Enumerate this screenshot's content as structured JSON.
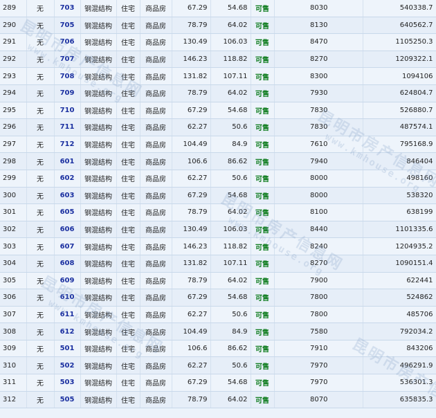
{
  "watermark": {
    "name": "昆明市房产信息网",
    "url": "www.kmhouse.org"
  },
  "rows": [
    [
      "289",
      "无",
      "703",
      "钢混结构",
      "住宅",
      "商品房",
      "67.29",
      "54.68",
      "可售",
      "8030",
      "540338.7"
    ],
    [
      "290",
      "无",
      "705",
      "钢混结构",
      "住宅",
      "商品房",
      "78.79",
      "64.02",
      "可售",
      "8130",
      "640562.7"
    ],
    [
      "291",
      "无",
      "706",
      "钢混结构",
      "住宅",
      "商品房",
      "130.49",
      "106.03",
      "可售",
      "8470",
      "1105250.3"
    ],
    [
      "292",
      "无",
      "707",
      "钢混结构",
      "住宅",
      "商品房",
      "146.23",
      "118.82",
      "可售",
      "8270",
      "1209322.1"
    ],
    [
      "293",
      "无",
      "708",
      "钢混结构",
      "住宅",
      "商品房",
      "131.82",
      "107.11",
      "可售",
      "8300",
      "1094106"
    ],
    [
      "294",
      "无",
      "709",
      "钢混结构",
      "住宅",
      "商品房",
      "78.79",
      "64.02",
      "可售",
      "7930",
      "624804.7"
    ],
    [
      "295",
      "无",
      "710",
      "钢混结构",
      "住宅",
      "商品房",
      "67.29",
      "54.68",
      "可售",
      "7830",
      "526880.7"
    ],
    [
      "296",
      "无",
      "711",
      "钢混结构",
      "住宅",
      "商品房",
      "62.27",
      "50.6",
      "可售",
      "7830",
      "487574.1"
    ],
    [
      "297",
      "无",
      "712",
      "钢混结构",
      "住宅",
      "商品房",
      "104.49",
      "84.9",
      "可售",
      "7610",
      "795168.9"
    ],
    [
      "298",
      "无",
      "601",
      "钢混结构",
      "住宅",
      "商品房",
      "106.6",
      "86.62",
      "可售",
      "7940",
      "846404"
    ],
    [
      "299",
      "无",
      "602",
      "钢混结构",
      "住宅",
      "商品房",
      "62.27",
      "50.6",
      "可售",
      "8000",
      "498160"
    ],
    [
      "300",
      "无",
      "603",
      "钢混结构",
      "住宅",
      "商品房",
      "67.29",
      "54.68",
      "可售",
      "8000",
      "538320"
    ],
    [
      "301",
      "无",
      "605",
      "钢混结构",
      "住宅",
      "商品房",
      "78.79",
      "64.02",
      "可售",
      "8100",
      "638199"
    ],
    [
      "302",
      "无",
      "606",
      "钢混结构",
      "住宅",
      "商品房",
      "130.49",
      "106.03",
      "可售",
      "8440",
      "1101335.6"
    ],
    [
      "303",
      "无",
      "607",
      "钢混结构",
      "住宅",
      "商品房",
      "146.23",
      "118.82",
      "可售",
      "8240",
      "1204935.2"
    ],
    [
      "304",
      "无",
      "608",
      "钢混结构",
      "住宅",
      "商品房",
      "131.82",
      "107.11",
      "可售",
      "8270",
      "1090151.4"
    ],
    [
      "305",
      "无",
      "609",
      "钢混结构",
      "住宅",
      "商品房",
      "78.79",
      "64.02",
      "可售",
      "7900",
      "622441"
    ],
    [
      "306",
      "无",
      "610",
      "钢混结构",
      "住宅",
      "商品房",
      "67.29",
      "54.68",
      "可售",
      "7800",
      "524862"
    ],
    [
      "307",
      "无",
      "611",
      "钢混结构",
      "住宅",
      "商品房",
      "62.27",
      "50.6",
      "可售",
      "7800",
      "485706"
    ],
    [
      "308",
      "无",
      "612",
      "钢混结构",
      "住宅",
      "商品房",
      "104.49",
      "84.9",
      "可售",
      "7580",
      "792034.2"
    ],
    [
      "309",
      "无",
      "501",
      "钢混结构",
      "住宅",
      "商品房",
      "106.6",
      "86.62",
      "可售",
      "7910",
      "843206"
    ],
    [
      "310",
      "无",
      "502",
      "钢混结构",
      "住宅",
      "商品房",
      "62.27",
      "50.6",
      "可售",
      "7970",
      "496291.9"
    ],
    [
      "311",
      "无",
      "503",
      "钢混结构",
      "住宅",
      "商品房",
      "67.29",
      "54.68",
      "可售",
      "7970",
      "536301.3"
    ],
    [
      "312",
      "无",
      "505",
      "钢混结构",
      "住宅",
      "商品房",
      "78.79",
      "64.02",
      "可售",
      "8070",
      "635835.3"
    ]
  ]
}
